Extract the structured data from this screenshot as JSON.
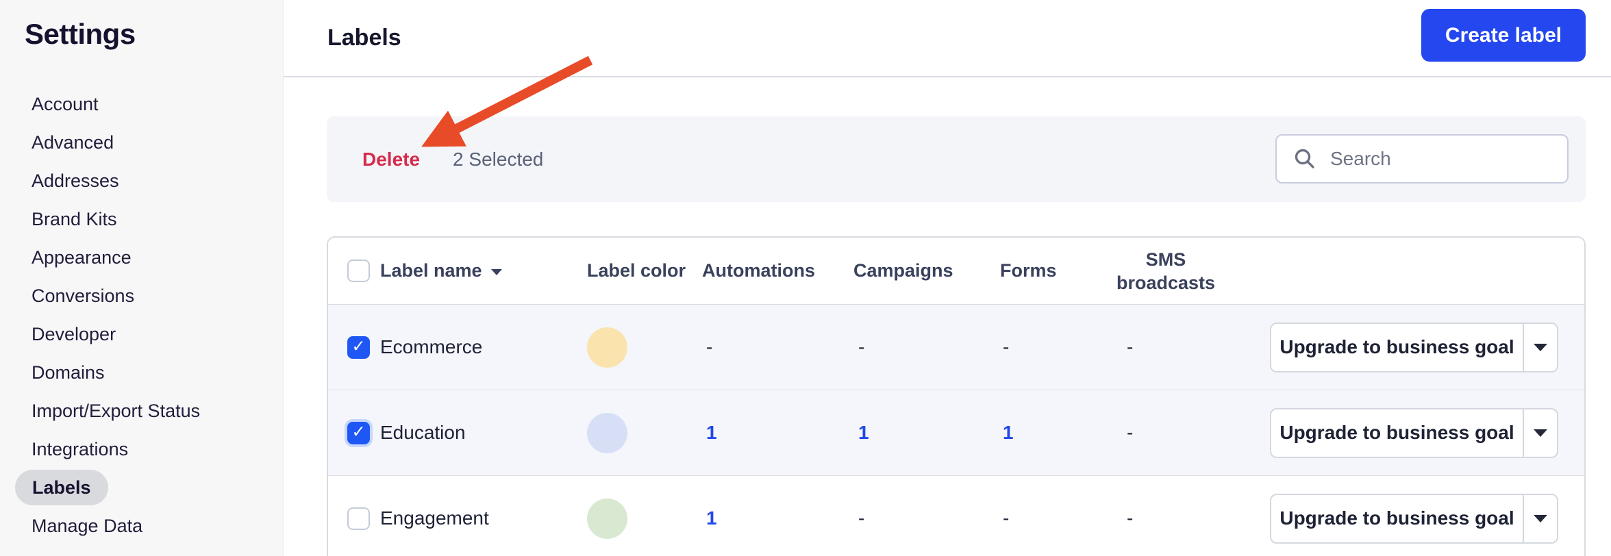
{
  "sidebar": {
    "title": "Settings",
    "items": [
      {
        "label": "Account",
        "active": false
      },
      {
        "label": "Advanced",
        "active": false
      },
      {
        "label": "Addresses",
        "active": false
      },
      {
        "label": "Brand Kits",
        "active": false
      },
      {
        "label": "Appearance",
        "active": false
      },
      {
        "label": "Conversions",
        "active": false
      },
      {
        "label": "Developer",
        "active": false
      },
      {
        "label": "Domains",
        "active": false
      },
      {
        "label": "Import/Export Status",
        "active": false
      },
      {
        "label": "Integrations",
        "active": false
      },
      {
        "label": "Labels",
        "active": true
      },
      {
        "label": "Manage Data",
        "active": false
      }
    ]
  },
  "header": {
    "title": "Labels",
    "create_button_label": "Create label"
  },
  "toolbar": {
    "delete_label": "Delete",
    "selected_count": "2 Selected",
    "search_placeholder": "Search",
    "search_icon": "magnifier"
  },
  "annotation": {
    "arrow_icon": "red-arrow-pointing-to-delete"
  },
  "table": {
    "columns": {
      "name": "Label name",
      "color": "Label color",
      "automations": "Automations",
      "campaigns": "Campaigns",
      "forms": "Forms",
      "sms": "SMS broadcasts"
    },
    "sort": {
      "column": "Label name",
      "direction": "desc"
    },
    "rows": [
      {
        "name": "Ecommerce",
        "checked": true,
        "focus_ring": false,
        "color": "#fae3ad",
        "automations": "-",
        "campaigns": "-",
        "forms": "-",
        "sms": "-",
        "action_label": "Upgrade to business goal"
      },
      {
        "name": "Education",
        "checked": true,
        "focus_ring": true,
        "color": "#d7dff7",
        "automations": "1",
        "campaigns": "1",
        "forms": "1",
        "sms": "-",
        "action_label": "Upgrade to business goal"
      },
      {
        "name": "Engagement",
        "checked": false,
        "focus_ring": false,
        "color": "#d9e8d1",
        "automations": "1",
        "campaigns": "-",
        "forms": "-",
        "sms": "-",
        "action_label": "Upgrade to business goal"
      }
    ]
  },
  "colors": {
    "accent_blue": "#2447f0",
    "checkbox_blue": "#1f57f5",
    "link_blue": "#2148ea",
    "delete_red": "#d52b4c",
    "arrow_red": "#e84b28",
    "toolbar_bg": "#f4f5f9",
    "selected_row_bg": "#f5f6fb",
    "active_pill_bg": "#d9dade",
    "sidebar_bg": "#f7f7f8"
  }
}
